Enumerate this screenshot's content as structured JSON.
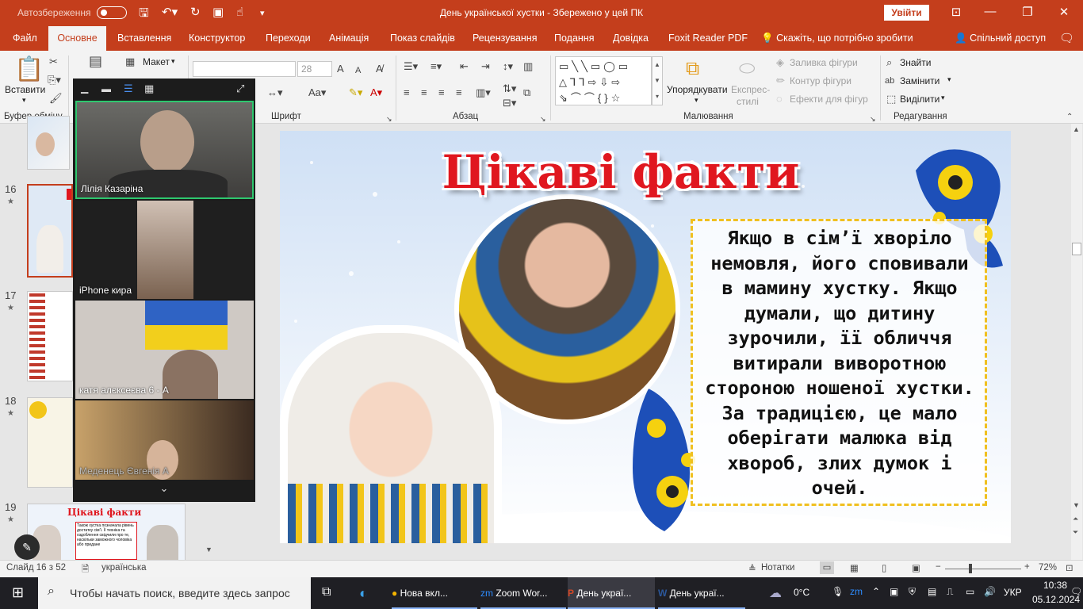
{
  "titlebar": {
    "autosave_label": "Автозбереження",
    "doc_title": "День української хустки  -  Збережено у цей ПК",
    "signin": "Увійти"
  },
  "tabs": [
    "Файл",
    "Основне",
    "Вставлення",
    "Конструктор",
    "Переходи",
    "Анімація",
    "Показ слайдів",
    "Рецензування",
    "Подання",
    "Довідка",
    "Foxit Reader PDF"
  ],
  "tellme": "Скажіть, що потрібно зробити",
  "share": "Спільний доступ",
  "ribbon": {
    "paste": "Вставити",
    "clipboard_group": "Буфер обміну",
    "layout": "Макет",
    "font_size": "28",
    "font_group": "Шрифт",
    "paragraph_group": "Абзац",
    "arrange": "Упорядкувати",
    "quick_styles_1": "Експрес-",
    "quick_styles_2": "стилі",
    "shape_fill": "Заливка фігури",
    "shape_outline": "Контур фігури",
    "shape_effects": "Ефекти для фігур",
    "drawing_group": "Малювання",
    "find": "Знайти",
    "replace": "Замінити",
    "select": "Виділити",
    "editing_group": "Редагування"
  },
  "thumbs": {
    "slides": [
      {
        "num": "16",
        "star": "★"
      },
      {
        "num": "17",
        "star": "★"
      },
      {
        "num": "18",
        "star": "★"
      },
      {
        "num": "19",
        "star": "★"
      }
    ],
    "thumb19_title": "Цікаві факти",
    "thumb19_text": "Також хустка позначала рівень достатку сім'ї. Її техніка та оздоблення свідчили про те, наскільки заможного чоловіка або придане"
  },
  "slide": {
    "heading": "Цікаві факти",
    "fact_lines": [
      "Якщо в сім’ї хворіло",
      "немовля, його сповивали",
      "в мамину хустку. Якщо",
      "думали, що дитину",
      "зурочили, її обличчя",
      "витирали виворотною",
      "стороною ношеної хустки.",
      "За традицією, це мало",
      "оберігати малюка від",
      "хвороб, злих думок і",
      "очей."
    ]
  },
  "zoom": {
    "participants": [
      {
        "name": "Лілія Казаріна"
      },
      {
        "name": "iPhone кира"
      },
      {
        "name": "катя алєксеєва 6 - А"
      },
      {
        "name": "Меденець Євгенія А"
      }
    ]
  },
  "status": {
    "slide_info": "Слайд 16 з 52",
    "language": "українська",
    "notes": "Нотатки",
    "zoom_level": "72%"
  },
  "taskbar": {
    "search_placeholder": "Чтобы начать поиск, введите здесь запрос",
    "apps": [
      "Нова вкл...",
      "Zoom Wor...",
      "День украї...",
      "День украї..."
    ],
    "weather": "0°C",
    "lang": "УКР",
    "time": "10:38",
    "date": "05.12.2024"
  },
  "colors": {
    "accent": "#c43e1c",
    "heading": "#e0171f",
    "zoom_active": "#2ec76e"
  }
}
